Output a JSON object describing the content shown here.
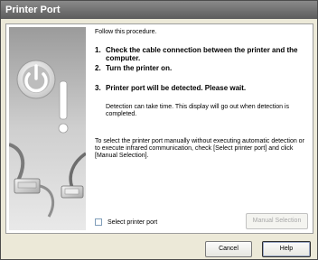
{
  "window": {
    "title": "Printer Port"
  },
  "instructions": {
    "intro": "Follow this procedure.",
    "steps": [
      {
        "num": "1.",
        "text": "Check the cable connection between the printer and the computer."
      },
      {
        "num": "2.",
        "text": "Turn the printer on."
      },
      {
        "num": "3.",
        "text": "Printer port will be detected. Please wait."
      }
    ],
    "note": "Detection can take time. This display will go out when detection is completed.",
    "manual": "To select the printer port manually without executing automatic detection or to execute infrared communication, check [Select printer port] and click [Manual Selection]."
  },
  "options": {
    "select_port_label": "Select printer port",
    "select_port_checked": false
  },
  "buttons": {
    "manual_selection": "Manual Selection",
    "cancel": "Cancel",
    "help": "Help"
  },
  "colors": {
    "titlebar": "#6e6e6e",
    "dialog_bg": "#ece9d8",
    "panel_bg": "#ffffff"
  },
  "icons": [
    "power-icon",
    "exclamation-icon",
    "cable-connector-icon",
    "usb-plug-icon"
  ]
}
